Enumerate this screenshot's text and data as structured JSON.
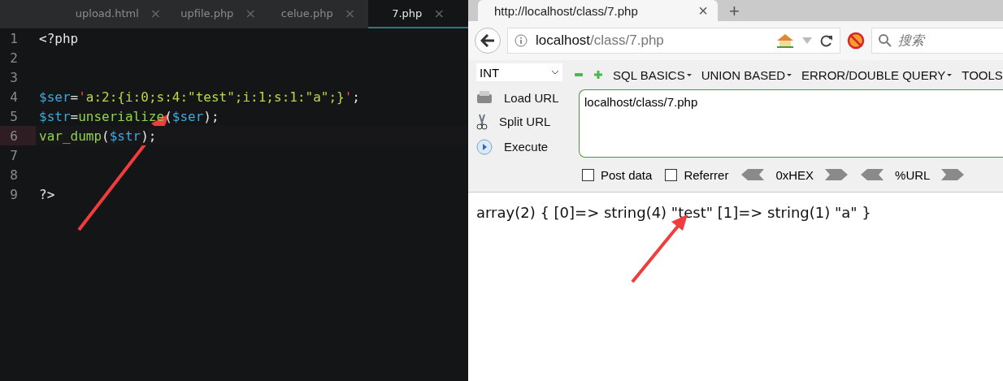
{
  "editor": {
    "tabs": [
      {
        "label": "upload.html",
        "close": "×",
        "selected": false
      },
      {
        "label": "upfile.php",
        "close": "×",
        "selected": false
      },
      {
        "label": "celue.php",
        "close": "×",
        "selected": false
      },
      {
        "label": "7.php",
        "close": "×",
        "selected": true
      }
    ],
    "lines": [
      {
        "number": "1",
        "current": false,
        "tokens": [
          {
            "kind": "plain",
            "text": "<?php"
          }
        ]
      },
      {
        "number": "2",
        "current": false
      },
      {
        "number": "3",
        "current": false
      },
      {
        "number": "4",
        "current": false,
        "tokens": [
          {
            "kind": "var",
            "text": "$ser"
          },
          {
            "kind": "op",
            "text": "="
          },
          {
            "kind": "quote",
            "text": "'"
          },
          {
            "kind": "str",
            "text": "a:2:{i:0;s:4:\"test\";i:1;s:1:\"a\";}"
          },
          {
            "kind": "quote",
            "text": "'"
          },
          {
            "kind": "plain",
            "text": ";"
          }
        ]
      },
      {
        "number": "5",
        "current": false,
        "tokens": [
          {
            "kind": "var",
            "text": "$str"
          },
          {
            "kind": "op",
            "text": "="
          },
          {
            "kind": "func",
            "text": "unserialize"
          },
          {
            "kind": "plain",
            "text": "("
          },
          {
            "kind": "var",
            "text": "$ser"
          },
          {
            "kind": "plain",
            "text": ");"
          }
        ]
      },
      {
        "number": "6",
        "current": true,
        "tokens": [
          {
            "kind": "func",
            "text": "var_dump"
          },
          {
            "kind": "plain",
            "text": "("
          },
          {
            "kind": "var",
            "text": "$str"
          },
          {
            "kind": "plain",
            "text": ");"
          }
        ]
      },
      {
        "number": "7",
        "current": false
      },
      {
        "number": "8",
        "current": false
      },
      {
        "number": "9",
        "current": false,
        "tokens": [
          {
            "kind": "plain",
            "text": "?>"
          }
        ]
      }
    ]
  },
  "browser": {
    "tab": {
      "title": "http://localhost/class/7.php",
      "close": "×",
      "new_tab": "+"
    },
    "address": {
      "host": "localhost",
      "path": "/class/7.php"
    },
    "search": {
      "placeholder": "搜索"
    },
    "hackbar": {
      "select": "INT",
      "menus": [
        "SQL BASICS",
        "UNION BASED",
        "ERROR/DOUBLE QUERY",
        "TOOLS"
      ],
      "actions": [
        {
          "kind": "load",
          "label": "Load URL"
        },
        {
          "kind": "split",
          "label": "Split URL"
        },
        {
          "kind": "execute",
          "label": "Execute"
        }
      ],
      "url": "localhost/class/7.php",
      "checks": [
        {
          "label": "Post data",
          "checked": false
        },
        {
          "label": "Referrer",
          "checked": false
        }
      ],
      "encoders": [
        "0xHEX",
        "%URL"
      ]
    },
    "output": "array(2) { [0]=> string(4) \"test\" [1]=> string(1) \"a\" }"
  }
}
